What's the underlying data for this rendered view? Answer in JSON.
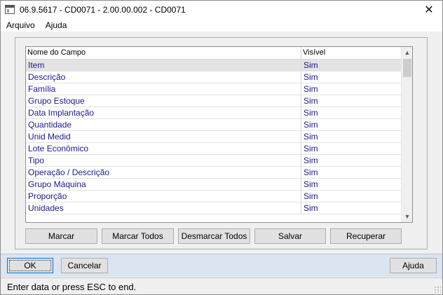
{
  "window": {
    "title": "06.9.5617 - CD0071 - 2.00.00.002 - CD0071",
    "close_glyph": "✕"
  },
  "menu": {
    "items": [
      {
        "label": "Arquivo"
      },
      {
        "label": "Ajuda"
      }
    ]
  },
  "grid": {
    "columns": {
      "name": "Nome do Campo",
      "visible": "Visível"
    },
    "selected_row": 0,
    "rows": [
      {
        "name": "Item",
        "visible": "Sim"
      },
      {
        "name": "Descrição",
        "visible": "Sim"
      },
      {
        "name": "Família",
        "visible": "Sim"
      },
      {
        "name": "Grupo Estoque",
        "visible": "Sim"
      },
      {
        "name": "Data Implantação",
        "visible": "Sim"
      },
      {
        "name": "Quantidade",
        "visible": "Sim"
      },
      {
        "name": "Unid Medid",
        "visible": "Sim"
      },
      {
        "name": "Lote Econômico",
        "visible": "Sim"
      },
      {
        "name": "Tipo",
        "visible": "Sim"
      },
      {
        "name": "Operação / Descrição",
        "visible": "Sim"
      },
      {
        "name": "Grupo Máquina",
        "visible": "Sim"
      },
      {
        "name": "Proporção",
        "visible": "Sim"
      },
      {
        "name": "Unidades",
        "visible": "Sim"
      }
    ],
    "scroll_up_glyph": "▲",
    "scroll_down_glyph": "▼"
  },
  "actions": {
    "marcar": "Marcar",
    "marcar_todos": "Marcar Todos",
    "desmarcar_todos": "Desmarcar Todos",
    "salvar": "Salvar",
    "recuperar": "Recuperar"
  },
  "footer": {
    "ok": "OK",
    "cancelar": "Cancelar",
    "ajuda": "Ajuda"
  },
  "status": {
    "text": "Enter data or press ESC to end."
  },
  "colors": {
    "cell_text": "#1a1a8c",
    "selected_row_bg": "#e3e3e3",
    "footer_band": "#dbe4f1"
  },
  "icons": {
    "app": "window-app-icon",
    "close": "close-icon",
    "scroll_up": "chevron-up-icon",
    "scroll_down": "chevron-down-icon",
    "grip": "resize-grip-icon"
  }
}
